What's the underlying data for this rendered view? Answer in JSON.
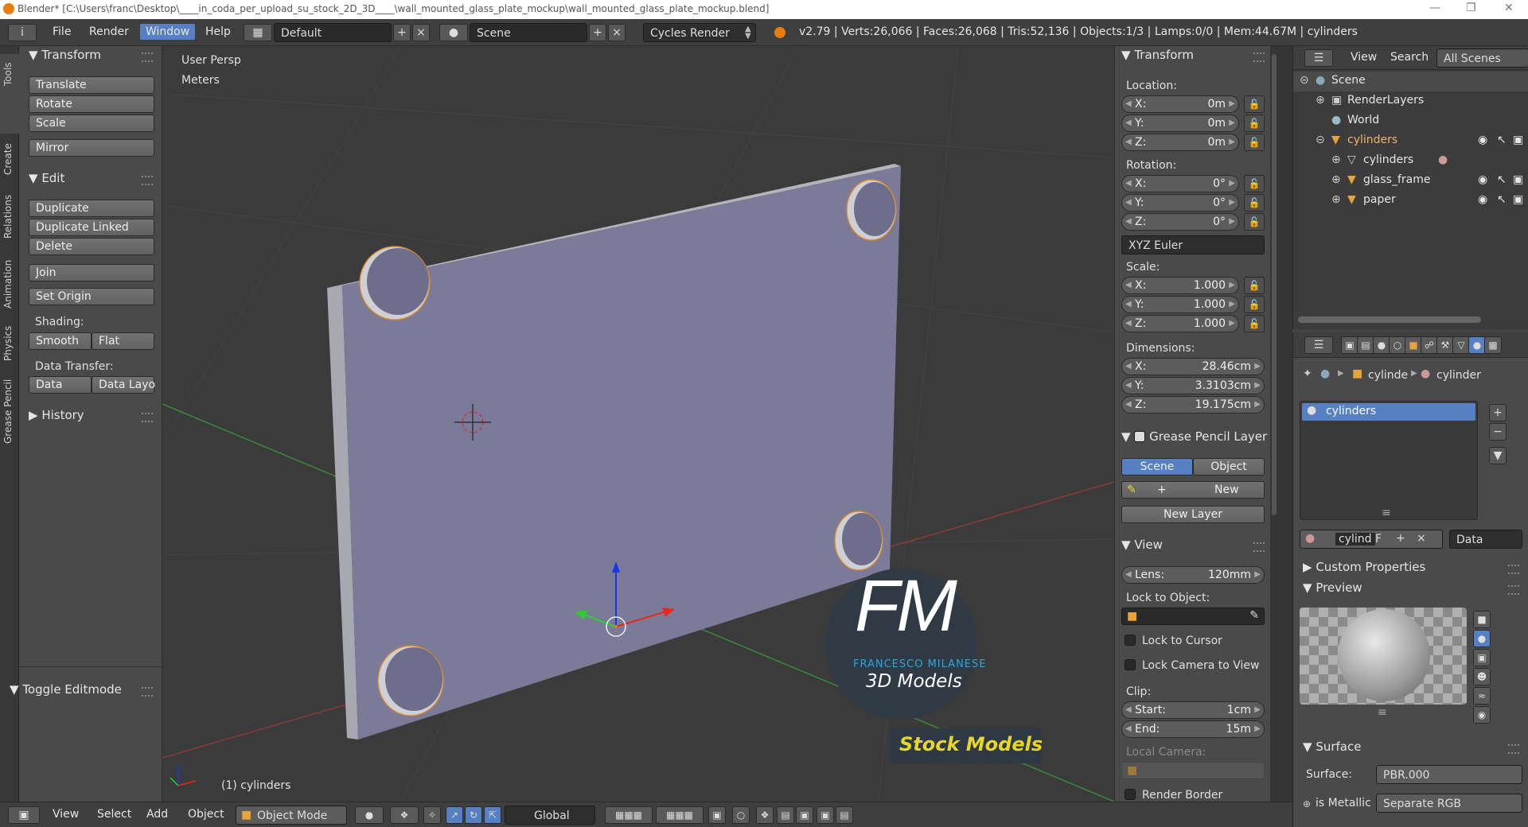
{
  "titlebar": {
    "title": "Blender* [C:\\Users\\franc\\Desktop\\____in_coda_per_upload_su_stock_2D_3D____\\wall_mounted_glass_plate_mockup\\wall_mounted_glass_plate_mockup.blend]"
  },
  "menubar": {
    "menus": [
      "File",
      "Render",
      "Window",
      "Help"
    ],
    "layout": "Default",
    "scene": "Scene",
    "engine": "Cycles Render",
    "stats": "v2.79 | Verts:26,066 | Faces:26,068 | Tris:52,136 | Objects:1/3 | Lamps:0/0 | Mem:44.67M | cylinders"
  },
  "tabs": [
    "Tools",
    "Create",
    "Relations",
    "Animation",
    "Physics",
    "Grease Pencil"
  ],
  "toolshelf": {
    "transform_title": "Transform",
    "translate": "Translate",
    "rotate": "Rotate",
    "scale": "Scale",
    "mirror": "Mirror",
    "edit_title": "Edit",
    "duplicate": "Duplicate",
    "duplicate_linked": "Duplicate Linked",
    "delete": "Delete",
    "join": "Join",
    "set_origin": "Set Origin",
    "shading_label": "Shading:",
    "smooth": "Smooth",
    "flat": "Flat",
    "data_transfer_label": "Data Transfer:",
    "data": "Data",
    "data_layout": "Data Layo",
    "history_title": "History",
    "toggle_editmode": "Toggle Editmode"
  },
  "viewport": {
    "view_name": "User Persp",
    "units": "Meters",
    "object_label": "(1) cylinders",
    "watermark_main": "FM",
    "watermark_name": "FRANCESCO MILANESE",
    "watermark_sub": "3D Models",
    "watermark_stock": "Stock Models"
  },
  "npanel": {
    "transform_title": "Transform",
    "location_label": "Location:",
    "loc": [
      {
        "k": "X:",
        "v": "0m"
      },
      {
        "k": "Y:",
        "v": "0m"
      },
      {
        "k": "Z:",
        "v": "0m"
      }
    ],
    "rotation_label": "Rotation:",
    "rot": [
      {
        "k": "X:",
        "v": "0°"
      },
      {
        "k": "Y:",
        "v": "0°"
      },
      {
        "k": "Z:",
        "v": "0°"
      }
    ],
    "rotation_mode": "XYZ Euler",
    "scale_label": "Scale:",
    "scl": [
      {
        "k": "X:",
        "v": "1.000"
      },
      {
        "k": "Y:",
        "v": "1.000"
      },
      {
        "k": "Z:",
        "v": "1.000"
      }
    ],
    "dimensions_label": "Dimensions:",
    "dim": [
      {
        "k": "X:",
        "v": "28.46cm"
      },
      {
        "k": "Y:",
        "v": "3.3103cm"
      },
      {
        "k": "Z:",
        "v": "19.175cm"
      }
    ],
    "gp_title": "Grease Pencil Layer",
    "gp_scene": "Scene",
    "gp_object": "Object",
    "gp_new": "New",
    "gp_new_layer": "New Layer",
    "view_title": "View",
    "lens_label": "Lens:",
    "lens_value": "120mm",
    "lock_to_object": "Lock to Object:",
    "lock_to_cursor": "Lock to Cursor",
    "lock_camera": "Lock Camera to View",
    "clip_label": "Clip:",
    "clip_start_label": "Start:",
    "clip_start_value": "1cm",
    "clip_end_label": "End:",
    "clip_end_value": "15m",
    "local_camera": "Local Camera:",
    "render_border": "Render Border"
  },
  "outliner": {
    "view": "View",
    "search": "Search",
    "filter": "All Scenes",
    "items": [
      "Scene",
      "RenderLayers",
      "World",
      "cylinders",
      "cylinders",
      "glass_frame",
      "paper"
    ]
  },
  "properties": {
    "breadcrumb_a": "cylinde",
    "breadcrumb_b": "cylinder",
    "material_slot": "cylinders",
    "material_name": "cylind",
    "fake_user": "F",
    "link_mode": "Data",
    "custom_properties": "Custom Properties",
    "preview_title": "Preview",
    "surface_title": "Surface",
    "surface_label": "Surface:",
    "surface_value": "PBR.000",
    "is_metallic_label": "is Metallic",
    "is_metallic_value": "Separate RGB"
  },
  "bottombar": {
    "menus": [
      "View",
      "Select",
      "Add",
      "Object"
    ],
    "mode": "Object Mode",
    "orientation": "Global"
  },
  "colors": {
    "accent": "#5680c2",
    "plate": "#7b7a99",
    "watermark_blue": "#29a7e1",
    "watermark_yellow": "#e8d62a"
  }
}
